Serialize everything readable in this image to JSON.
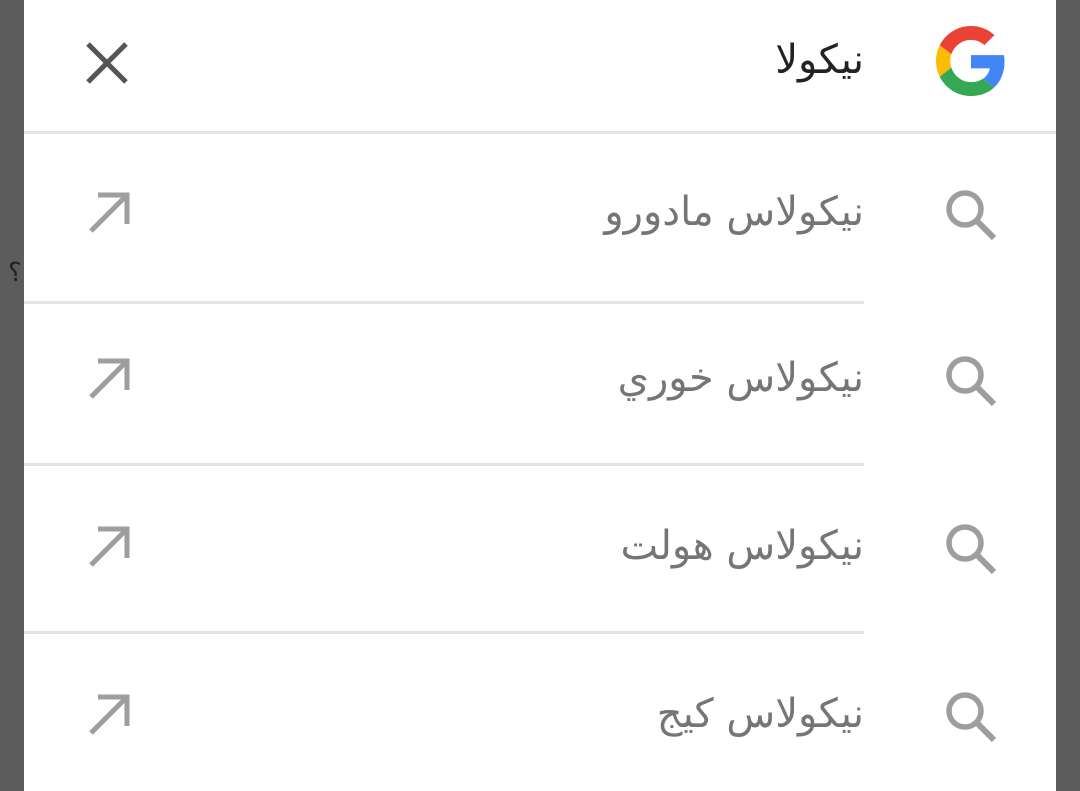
{
  "search": {
    "query": "نيكولا"
  },
  "suggestions": [
    {
      "label": "نيكولاس مادورو"
    },
    {
      "label": "نيكولاس خوري"
    },
    {
      "label": "نيكولاس هولت"
    },
    {
      "label": "نيكولاس كيج"
    }
  ],
  "background": {
    "partial_glyph": "؟"
  },
  "colors": {
    "google_blue": "#4285F4",
    "google_red": "#EA4335",
    "google_yellow": "#FBBC05",
    "google_green": "#34A853",
    "icon_gray": "#9e9e9e",
    "text_gray": "#757575",
    "query_text": "#222222",
    "divider": "#e4e4e4"
  },
  "icons": {
    "logo": "google-g-icon",
    "clear": "close-icon",
    "suggestion": "search-icon",
    "fill": "arrow-up-left-icon"
  }
}
